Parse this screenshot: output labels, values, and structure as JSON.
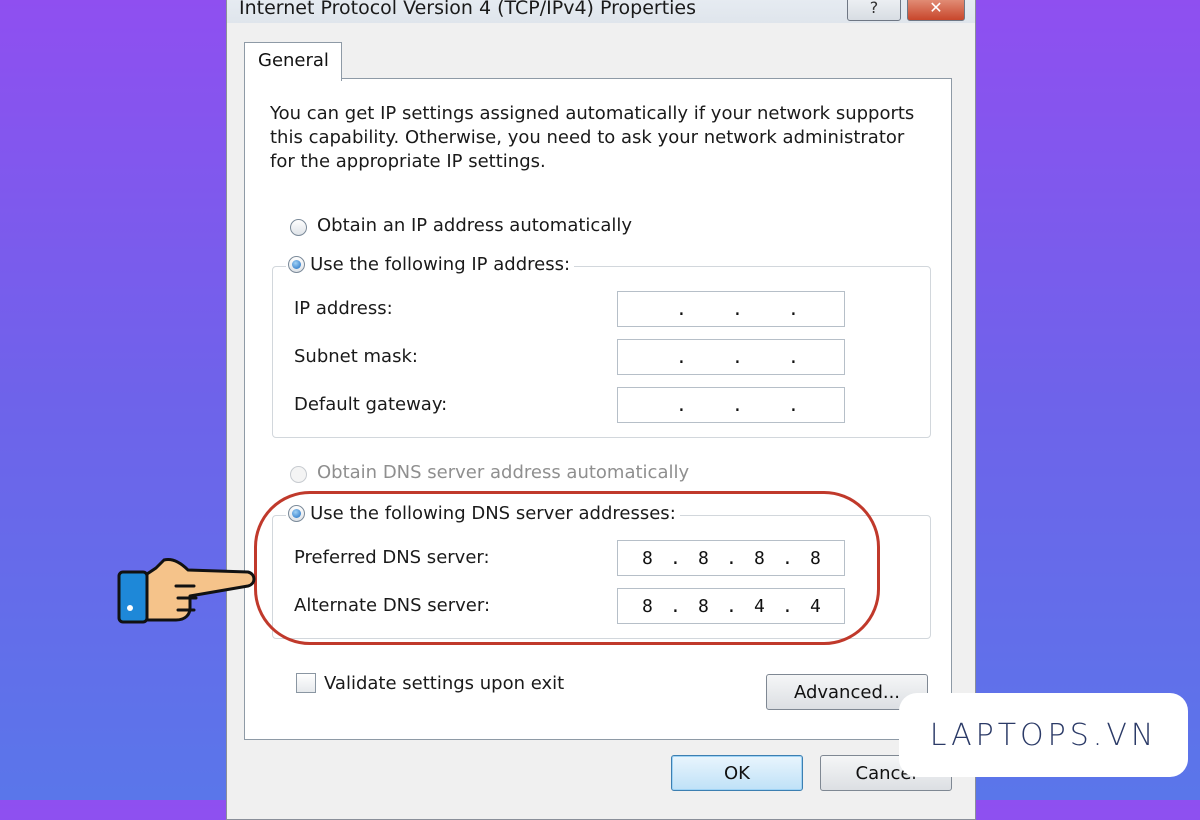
{
  "window": {
    "title": "Internet Protocol Version 4 (TCP/IPv4) Properties",
    "help_glyph": "?",
    "close_glyph": "✕"
  },
  "tab": {
    "label": "General"
  },
  "description": "You can get IP settings assigned automatically if your network supports\nthis capability. Otherwise, you need to ask your network administrator\nfor the appropriate IP settings.",
  "ip_section": {
    "auto_option": "Obtain an IP address automatically",
    "manual_option": "Use the following IP address:",
    "selected": "manual",
    "fields": [
      {
        "label": "IP address:",
        "octets": [
          "",
          "",
          "",
          ""
        ]
      },
      {
        "label": "Subnet mask:",
        "octets": [
          "",
          "",
          "",
          ""
        ]
      },
      {
        "label": "Default gateway:",
        "octets": [
          "",
          "",
          "",
          ""
        ]
      }
    ]
  },
  "dns_section": {
    "auto_option": "Obtain DNS server address automatically",
    "manual_option": "Use the following DNS server addresses:",
    "selected": "manual",
    "fields": [
      {
        "label": "Preferred DNS server:",
        "octets": [
          "8",
          "8",
          "8",
          "8"
        ]
      },
      {
        "label": "Alternate DNS server:",
        "octets": [
          "8",
          "8",
          "4",
          "4"
        ]
      }
    ]
  },
  "validate_label": "Validate settings upon exit",
  "buttons": {
    "advanced": "Advanced...",
    "ok": "OK",
    "cancel": "Cancel"
  },
  "watermark": "LAPTOPS.VN",
  "colors": {
    "background_top": "#8f4ff0",
    "background_bottom": "#5a76ea",
    "highlight": "#c0392b"
  },
  "icons": {
    "pointer": "pointing-hand-icon"
  }
}
